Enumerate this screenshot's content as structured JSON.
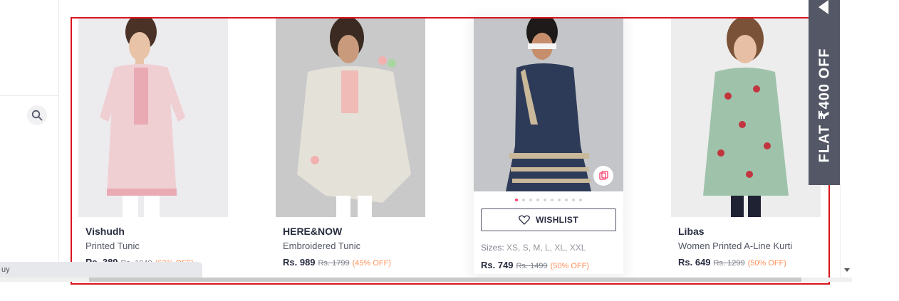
{
  "products": [
    {
      "brand": "Vishudh",
      "desc": "Printed Tunic",
      "price": "Rs. 389",
      "mrp": "Rs. 1049",
      "off": "(63% OFF)",
      "colors": {
        "bg": "#ecebee",
        "garment": "#f0cfd3",
        "accent": "#e59aa6"
      }
    },
    {
      "brand": "HERE&NOW",
      "desc": "Embroidered Tunic",
      "price": "Rs. 989",
      "mrp": "Rs. 1799",
      "off": "(45% OFF)",
      "colors": {
        "bg": "#c9c9c9",
        "garment": "#e4e1d9",
        "accent": "#f2b0ae"
      }
    },
    {
      "brand": "",
      "desc": "",
      "price": "Rs. 749",
      "mrp": "Rs. 1499",
      "off": "(50% OFF)",
      "wishlist_label": "WISHLIST",
      "sizes_label": "Sizes:",
      "sizes": "XS, S, M, L, XL, XXL",
      "colors": {
        "bg": "#c3c5c8",
        "garment": "#2e3b58",
        "accent": "#c9b99a"
      }
    },
    {
      "brand": "Libas",
      "desc": "Women Printed A-Line Kurti",
      "price": "Rs. 649",
      "mrp": "Rs. 1299",
      "off": "(50% OFF)",
      "colors": {
        "bg": "#ededed",
        "garment": "#9fc2ab",
        "accent": "#c2353f"
      }
    }
  ],
  "offer_banner": "FLAT ₹400 OFF",
  "tooltip_text": "uy",
  "icons": {
    "search": "search-icon",
    "heart": "heart-icon",
    "similar": "similar-icon",
    "arrow": "arrow-left-icon"
  }
}
